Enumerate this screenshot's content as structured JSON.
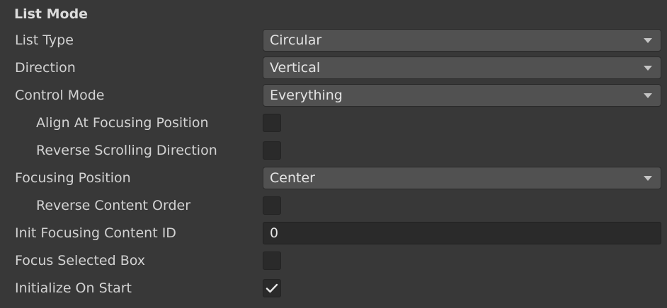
{
  "section": {
    "title": "List Mode"
  },
  "fields": {
    "list_type": {
      "label": "List Type",
      "value": "Circular"
    },
    "direction": {
      "label": "Direction",
      "value": "Vertical"
    },
    "control_mode": {
      "label": "Control Mode",
      "value": "Everything"
    },
    "align_at_focusing_position": {
      "label": "Align At Focusing Position",
      "checked": false
    },
    "reverse_scrolling_direction": {
      "label": "Reverse Scrolling Direction",
      "checked": false
    },
    "focusing_position": {
      "label": "Focusing Position",
      "value": "Center"
    },
    "reverse_content_order": {
      "label": "Reverse Content Order",
      "checked": false
    },
    "init_focusing_content_id": {
      "label": "Init Focusing Content ID",
      "value": "0"
    },
    "focus_selected_box": {
      "label": "Focus Selected Box",
      "checked": false
    },
    "initialize_on_start": {
      "label": "Initialize On Start",
      "checked": true
    }
  },
  "icons": {
    "dropdown_arrow": "triangle-down-icon",
    "checkmark": "checkmark-icon"
  },
  "colors": {
    "background": "#383838",
    "dropdown_bg": "#515151",
    "input_bg": "#2a2a2a",
    "text": "#d2d2d2"
  }
}
